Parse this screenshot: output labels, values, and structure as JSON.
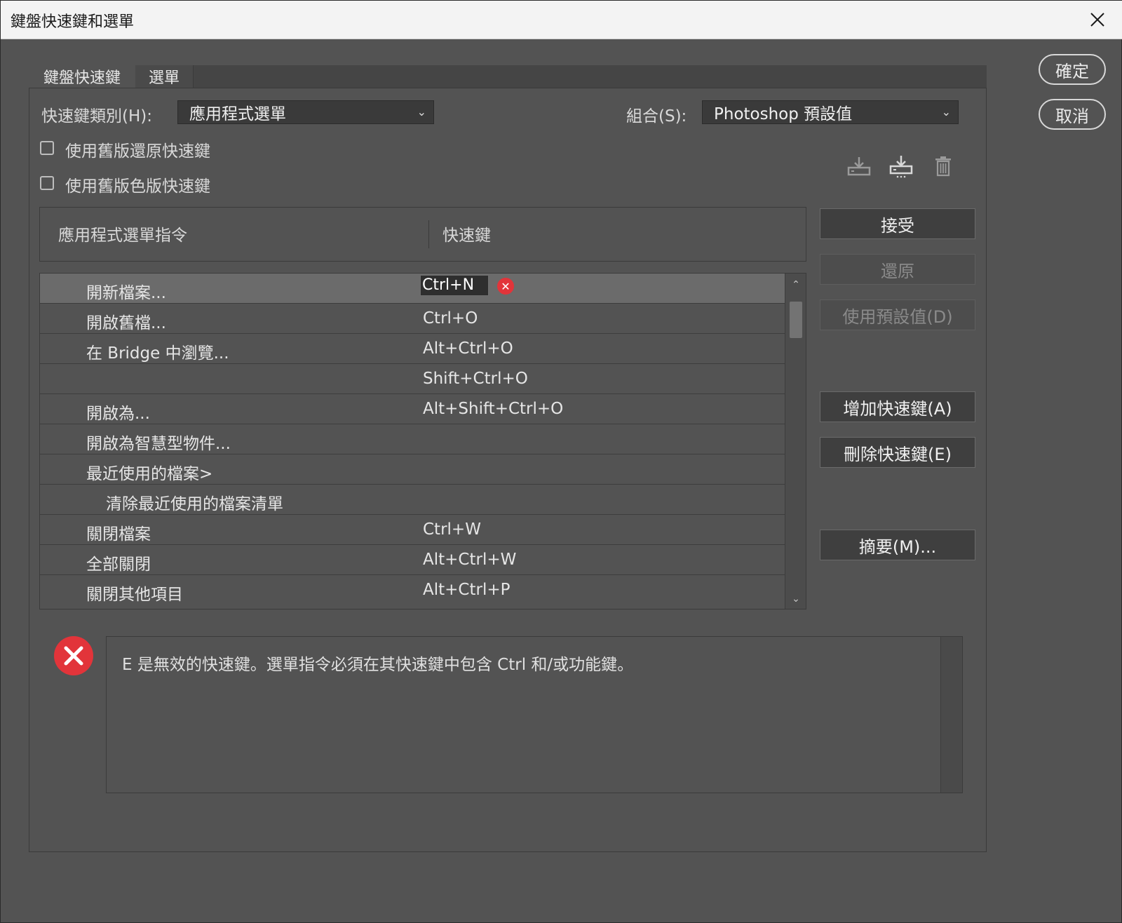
{
  "window": {
    "title": "鍵盤快速鍵和選單"
  },
  "dialog_buttons": {
    "ok": "確定",
    "cancel": "取消"
  },
  "tabs": [
    {
      "label": "鍵盤快速鍵",
      "active": true
    },
    {
      "label": "選單",
      "active": false
    }
  ],
  "controls": {
    "category_label": "快速鍵類別(H):",
    "category_value": "應用程式選單",
    "set_label": "組合(S):",
    "set_value": "Photoshop 預設值",
    "legacy_undo_label": "使用舊版還原快速鍵",
    "legacy_channel_label": "使用舊版色版快速鍵"
  },
  "icons": {
    "save_set": "save-set-icon",
    "save_as_set": "save-as-set-icon",
    "delete_set": "trash-icon"
  },
  "table": {
    "headers": [
      "應用程式選單指令",
      "快速鍵"
    ],
    "rows": [
      {
        "command": "開新檔案...",
        "shortcut": "Ctrl+N",
        "selected": true,
        "indent": 1
      },
      {
        "command": "開啟舊檔...",
        "shortcut": "Ctrl+O",
        "selected": false,
        "indent": 1
      },
      {
        "command": "在 Bridge 中瀏覽...",
        "shortcut": "Alt+Ctrl+O",
        "selected": false,
        "indent": 1
      },
      {
        "command": "",
        "shortcut": "Shift+Ctrl+O",
        "selected": false,
        "indent": 1
      },
      {
        "command": "開啟為...",
        "shortcut": "Alt+Shift+Ctrl+O",
        "selected": false,
        "indent": 1
      },
      {
        "command": "開啟為智慧型物件...",
        "shortcut": "",
        "selected": false,
        "indent": 1
      },
      {
        "command": "最近使用的檔案>",
        "shortcut": "",
        "selected": false,
        "indent": 1
      },
      {
        "command": "清除最近使用的檔案清單",
        "shortcut": "",
        "selected": false,
        "indent": 2
      },
      {
        "command": "關閉檔案",
        "shortcut": "Ctrl+W",
        "selected": false,
        "indent": 1
      },
      {
        "command": "全部關閉",
        "shortcut": "Alt+Ctrl+W",
        "selected": false,
        "indent": 1
      },
      {
        "command": "關閉其他項目",
        "shortcut": "Alt+Ctrl+P",
        "selected": false,
        "indent": 1
      }
    ]
  },
  "side_buttons": {
    "accept": "接受",
    "undo": "還原",
    "use_default": "使用預設值(D)",
    "add_shortcut": "增加快速鍵(A)",
    "delete_shortcut": "刪除快速鍵(E)",
    "summarize": "摘要(M)..."
  },
  "message": {
    "text": "E 是無效的快速鍵。選單指令必須在其快速鍵中包含 Ctrl 和/或功能鍵。"
  },
  "colors": {
    "background": "#535353",
    "error_red": "#e2343a",
    "selected_row": "#6b6b6b"
  }
}
